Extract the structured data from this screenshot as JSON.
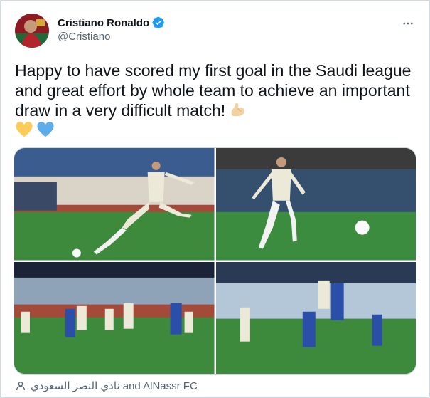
{
  "author": {
    "display_name": "Cristiano Ronaldo",
    "handle": "@Cristiano",
    "verified_icon": "verified-badge-icon",
    "avatar_icon": "avatar"
  },
  "menu": {
    "icon": "more-options-icon"
  },
  "tweet": {
    "text": "Happy to have scored my first goal in the Saudi league and great effort by whole team to achieve an important draw in a very difficult match!",
    "emojis": [
      "flexed-biceps-emoji",
      "yellow-heart-emoji",
      "blue-heart-emoji"
    ]
  },
  "media": {
    "photos": [
      {
        "name": "photo-1",
        "description_icon": "photo"
      },
      {
        "name": "photo-2",
        "description_icon": "photo"
      },
      {
        "name": "photo-3",
        "description_icon": "photo"
      },
      {
        "name": "photo-4",
        "description_icon": "photo"
      }
    ]
  },
  "tagged": {
    "icon": "person-tag-icon",
    "text": "نادي النصر السعودي and AlNassr FC"
  },
  "colors": {
    "text_primary": "#0f1419",
    "text_secondary": "#536471",
    "verified_blue": "#1d9bf0",
    "border": "#cfd9de"
  }
}
